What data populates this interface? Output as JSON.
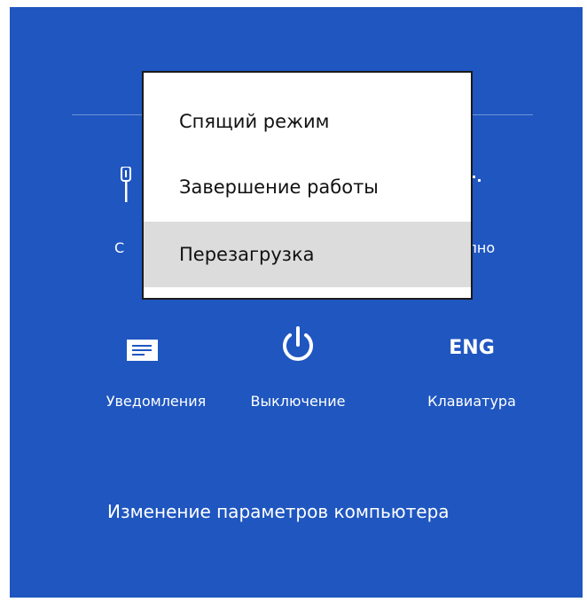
{
  "colors": {
    "panel_bg": "#1f56c0",
    "menu_bg": "#ffffff",
    "menu_highlight": "#dcdcdc"
  },
  "power_menu": {
    "items": [
      {
        "label": "Спящий режим",
        "icon": "none",
        "highlighted": false
      },
      {
        "label": "Завершение работы",
        "icon": "none",
        "highlighted": false
      },
      {
        "label": "Перезагрузка",
        "icon": "none",
        "highlighted": true
      }
    ]
  },
  "settings_row_top": {
    "left_label_fragment": "С",
    "right_label_fragment": "упно",
    "left_icon": "network-icon",
    "right_icon": "brightness-icon"
  },
  "settings_tiles": [
    {
      "label": "Уведомления",
      "icon": "notifications-icon"
    },
    {
      "label": "Выключение",
      "icon": "power-icon"
    },
    {
      "label": "Клавиатура",
      "icon": "keyboard-language-icon",
      "icon_text": "ENG"
    }
  ],
  "footer": {
    "link_label": "Изменение параметров компьютера"
  }
}
